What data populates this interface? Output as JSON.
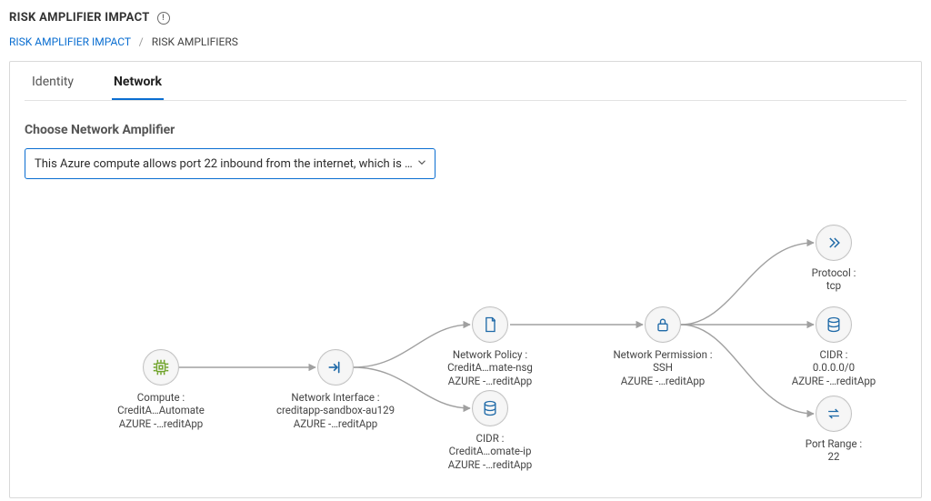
{
  "page": {
    "title": "RISK AMPLIFIER IMPACT"
  },
  "breadcrumb": {
    "root": "RISK AMPLIFIER IMPACT",
    "current": "RISK AMPLIFIERS"
  },
  "tabs": {
    "identity": "Identity",
    "network": "Network",
    "active": "network"
  },
  "amplifier": {
    "label": "Choose Network Amplifier",
    "selected": "This Azure compute allows port 22 inbound from the internet, which is …"
  },
  "graph": {
    "nodes": {
      "compute": {
        "title": "Compute :",
        "line1": "CreditA…Automate",
        "line2": "AZURE -…reditApp"
      },
      "nic": {
        "title": "Network Interface :",
        "line1": "creditapp-sandbox-au129",
        "line2": "AZURE -…reditApp"
      },
      "policy": {
        "title": "Network Policy :",
        "line1": "CreditA…mate-nsg",
        "line2": "AZURE -…reditApp"
      },
      "cidr_ip": {
        "title": "CIDR :",
        "line1": "CreditA…omate-ip",
        "line2": "AZURE -…reditApp"
      },
      "permission": {
        "title": "Network Permission :",
        "line1": "SSH",
        "line2": "AZURE -…reditApp"
      },
      "protocol": {
        "title": "Protocol :",
        "line1": "tcp"
      },
      "cidr_any": {
        "title": "CIDR :",
        "line1": "0.0.0.0/0",
        "line2": "AZURE -…reditApp"
      },
      "port": {
        "title": "Port Range :",
        "line1": "22"
      }
    }
  }
}
